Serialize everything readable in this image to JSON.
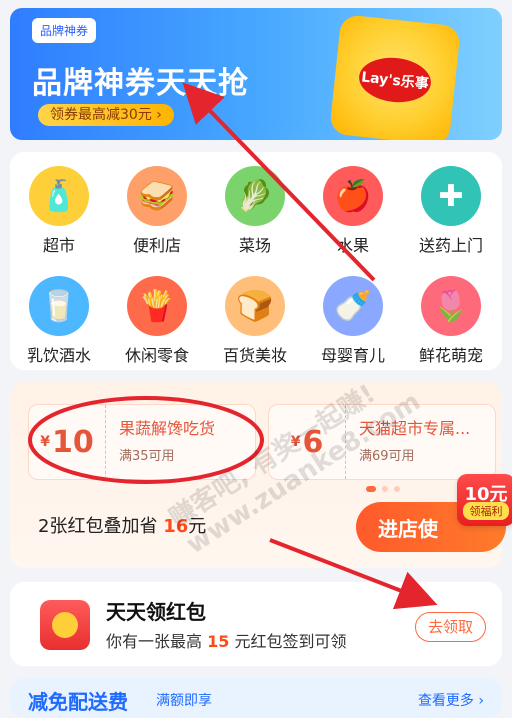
{
  "banner": {
    "tag": "品牌神券",
    "title": "品牌神券天天抢",
    "pill": "领券最高减30元 ›",
    "chips_brand": "Lay's乐事"
  },
  "categories": [
    {
      "label": "超市",
      "icon": "oil-bottle-icon",
      "bg": "#ffcf3a"
    },
    {
      "label": "便利店",
      "icon": "sandwich-icon",
      "bg": "#ff9f6a"
    },
    {
      "label": "菜场",
      "icon": "cabbage-icon",
      "bg": "#7ad36b"
    },
    {
      "label": "水果",
      "icon": "apple-icon",
      "bg": "#ff5b5b"
    },
    {
      "label": "送药上门",
      "icon": "medicine-kit-icon",
      "bg": "#32c3b7"
    },
    {
      "label": "乳饮酒水",
      "icon": "milk-bottle-icon",
      "bg": "#4db7ff"
    },
    {
      "label": "休闲零食",
      "icon": "chips-icon",
      "bg": "#ff6b4a"
    },
    {
      "label": "百货美妆",
      "icon": "bread-icon",
      "bg": "#ffbe7a"
    },
    {
      "label": "母婴育儿",
      "icon": "formula-can-icon",
      "bg": "#8aa8ff"
    },
    {
      "label": "鲜花萌宠",
      "icon": "tulip-icon",
      "bg": "#ff6a7a"
    }
  ],
  "coupons": [
    {
      "currency": "¥",
      "amount": "10",
      "name": "果蔬解馋吃货",
      "condition": "满35可用"
    },
    {
      "currency": "¥",
      "amount": "6",
      "name": "天猫超市专属...",
      "condition": "满69可用"
    }
  ],
  "summary": {
    "prefix": "2张红包叠加省 ",
    "value": "16",
    "suffix": "元"
  },
  "enter_button": "进店使",
  "red_tag": {
    "value": "10元",
    "label": "领福利"
  },
  "daily": {
    "title": "天天领红包",
    "desc_prefix": "你有一张最高 ",
    "desc_value": "15",
    "desc_suffix": " 元红包签到可领",
    "button": "去领取"
  },
  "bottom": {
    "left": "减免配送费",
    "middle": "满额即享",
    "right": "查看更多 ›"
  },
  "watermark": "赚客吧, 有奖一起赚! www.zuanke8.com",
  "colors": {
    "accent": "#ff4a1a",
    "blue": "#2f7dff",
    "annotation": "#e4252d"
  }
}
